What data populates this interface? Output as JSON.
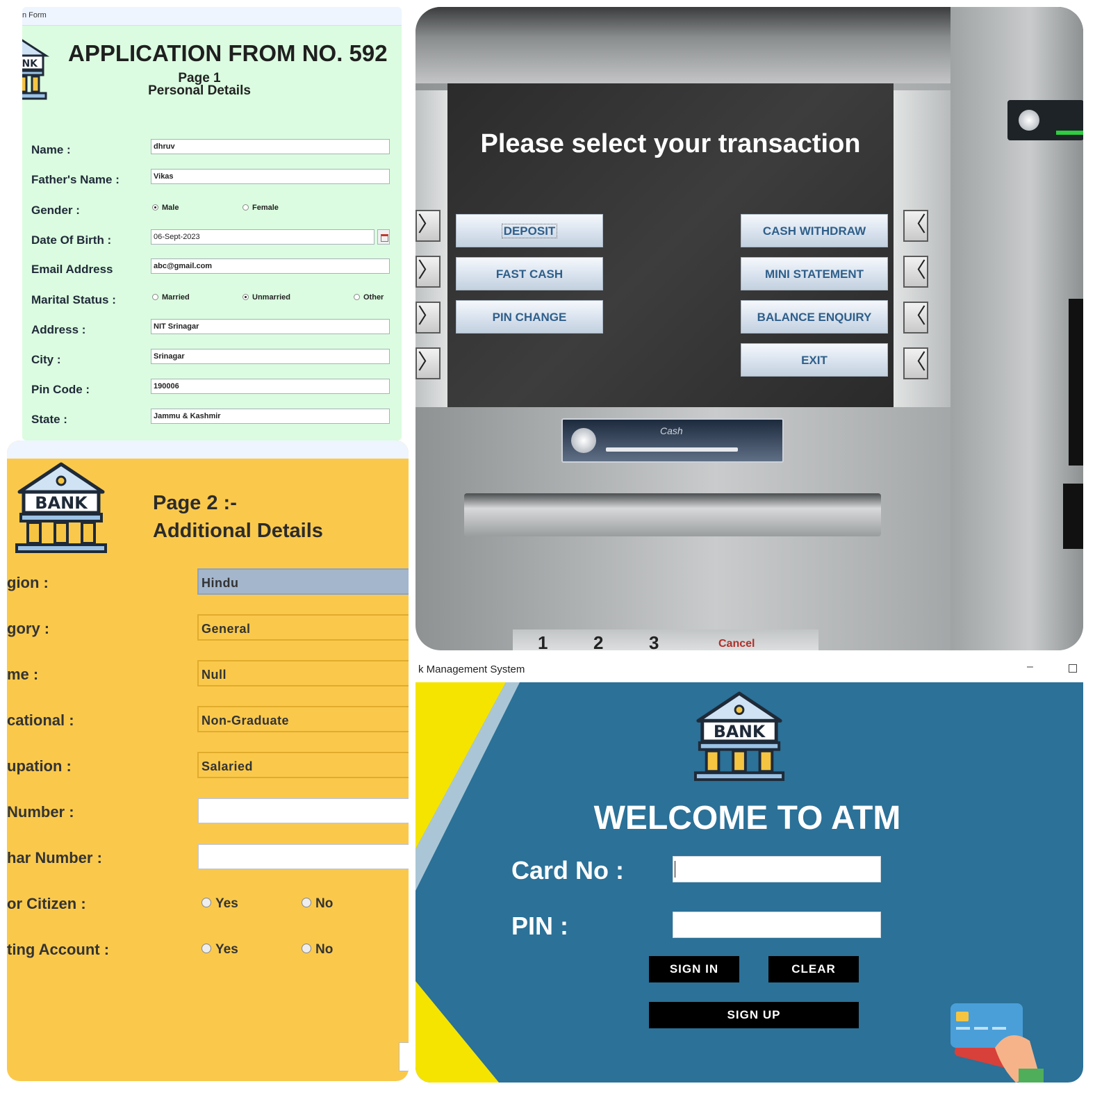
{
  "page1": {
    "window_title_fragment": "n Form",
    "title": "APPLICATION FROM NO. 592",
    "page_label": "Page 1",
    "section": "Personal Details",
    "fields": [
      {
        "label": "Name :",
        "value": "dhruv"
      },
      {
        "label": "Father's Name :",
        "value": "Vikas"
      },
      {
        "label": "Gender :",
        "options": [
          "Male",
          "Female"
        ],
        "selected": "Male"
      },
      {
        "label": "Date Of Birth :",
        "value": "06-Sept-2023"
      },
      {
        "label": "Email Address",
        "value": "abc@gmail.com"
      },
      {
        "label": "Marital Status :",
        "options": [
          "Married",
          "Unmarried",
          "Other"
        ],
        "selected": "Unmarried"
      },
      {
        "label": "Address :",
        "value": "NIT Srinagar"
      },
      {
        "label": "City :",
        "value": "Srinagar"
      },
      {
        "label": "Pin Code :",
        "value": "190006"
      },
      {
        "label": "State :",
        "value": "Jammu & Kashmir"
      }
    ]
  },
  "page2": {
    "logo_text": "BANK",
    "heading_line1": "Page 2 :-",
    "heading_line2": "Additional Details",
    "fields": [
      {
        "label": "gion :",
        "value": "Hindu"
      },
      {
        "label": "gory :",
        "value": "General"
      },
      {
        "label": "me :",
        "value": "Null"
      },
      {
        "label": "cational :",
        "value": "Non-Graduate"
      },
      {
        "label": "upation :",
        "value": "Salaried"
      },
      {
        "label": " Number :",
        "value": ""
      },
      {
        "label": "har Number :",
        "value": ""
      },
      {
        "label": "or Citizen :",
        "options": [
          "Yes",
          "No"
        ]
      },
      {
        "label": "ting Account :",
        "options": [
          "Yes",
          "No"
        ]
      }
    ]
  },
  "atm": {
    "message": "Please select your transaction",
    "left_buttons": [
      "DEPOSIT",
      "FAST CASH",
      "PIN CHANGE"
    ],
    "right_buttons": [
      "CASH WITHDRAW",
      "MINI STATEMENT",
      "BALANCE ENQUIRY",
      "EXIT"
    ],
    "side_left_glyph": "〉",
    "side_right_glyph": "〈",
    "card_slot_text": "Cash",
    "keypad_keys": [
      "1",
      "2",
      "3",
      "Cancel"
    ]
  },
  "login": {
    "window_title": "k Management System",
    "minimize_glyph": "–",
    "logo_text": "BANK",
    "welcome": "WELCOME TO ATM",
    "card_label": "Card No :",
    "pin_label": "PIN :",
    "sign_in": "SIGN IN",
    "clear": "CLEAR",
    "sign_up": "SIGN UP"
  },
  "colors": {
    "page1_bg": "#dbfce0",
    "page2_bg": "#fac94c",
    "atm_button_text": "#2f5f8a",
    "login_bg": "#2b7198",
    "login_accent": "#f5e400"
  }
}
